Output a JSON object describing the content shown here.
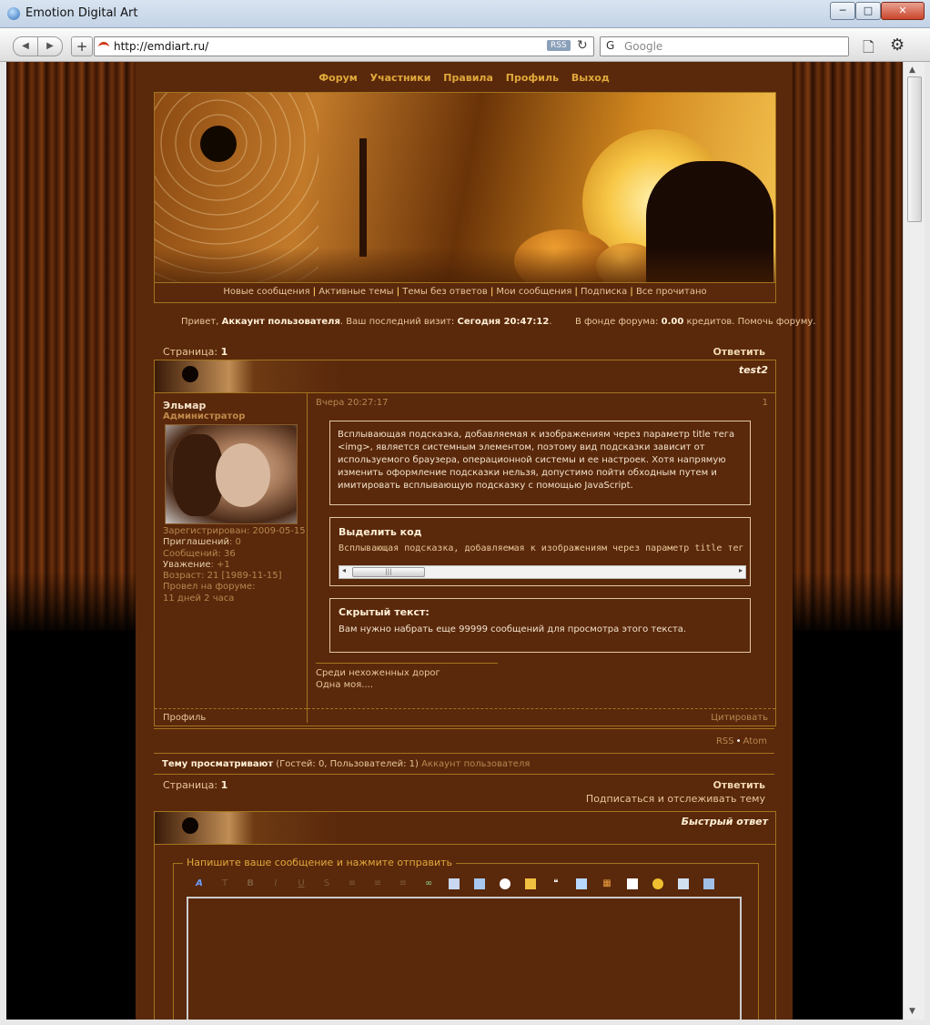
{
  "window": {
    "title": "Emotion Digital Art",
    "min": "─",
    "max": "□",
    "close": "✕"
  },
  "browser": {
    "url": "http://emdiart.ru/",
    "rss": "RSS",
    "search_placeholder": "Google",
    "back": "◀",
    "forward": "▶",
    "new_tab": "+",
    "reload": "↻",
    "search_icon": "G",
    "page_menu": "🗋",
    "tools_menu": "⚙"
  },
  "topnav": [
    "Форум",
    "Участники",
    "Правила",
    "Профиль",
    "Выход"
  ],
  "subnav": [
    "Новые сообщения",
    "Активные темы",
    "Темы без ответов",
    "Мои сообщения",
    "Подписка",
    "Все прочитано"
  ],
  "welcome": {
    "greeting": "Привет, ",
    "user": "Аккаунт пользователя",
    "last_visit_label": ".  Ваш последний визит: ",
    "last_visit": "Сегодня 20:47:12",
    "fund_label": ".        В фонде форума: ",
    "fund_value": "0.00",
    "fund_suffix": " кредитов. Помочь форуму."
  },
  "pagination": {
    "label": "Страница: ",
    "page": "1",
    "reply": "Ответить"
  },
  "topic": {
    "title": "test2"
  },
  "post": {
    "author": "Эльмар",
    "role": "Администратор",
    "registered": "Зарегистрирован: 2009-05-15",
    "invites_label": "Приглашений",
    "invites": ": 0",
    "messages": "Сообщений: 36",
    "respect_label": "Уважение",
    "respect": ": +1",
    "age": "Возраст: 21 [1989-11-15]",
    "online_label": "Провел на форуме:",
    "online_time": "11 дней 2 часа",
    "date": "Вчера 20:27:17",
    "number": "1",
    "text": "Всплывающая подсказка, добавляемая к изображениям через параметр title тега <img>, является системным элементом, поэтому вид подсказки зависит от используемого браузера, операционной системы и ее настроек. Хотя напрямую изменить оформление подсказки нельзя, допустимо пойти обходным путем и имитировать всплывающую подсказку с помощью JavaScript.",
    "code_title": "Выделить код",
    "code_text": "Всплывающая подсказка, добавляемая к изображениям через параметр title тега <img",
    "hidden_title": "Скрытый текст:",
    "hidden_text": "Вам нужно набрать еще 99999 сообщений для просмотра этого текста.",
    "signature_1": "Среди нехоженных дорог",
    "signature_2": "Одна моя....",
    "profile_link": "Профиль",
    "quote_link": "Цитировать"
  },
  "feeds": {
    "rss": "RSS",
    "atom": "Atom"
  },
  "viewers": {
    "label": "Тему просматривают",
    "counts": " (Гостей: 0, Пользователей: 1) ",
    "user": "Аккаунт пользователя"
  },
  "subscribe": "Подписаться и отслеживать тему",
  "quick_reply": {
    "title": "Быстрый ответ",
    "legend": "Напишите ваше сообщение и нажмите отправить"
  },
  "colors": {
    "page_bg": "#5a280b",
    "border": "#a3741f",
    "link": "#e0a93b"
  }
}
